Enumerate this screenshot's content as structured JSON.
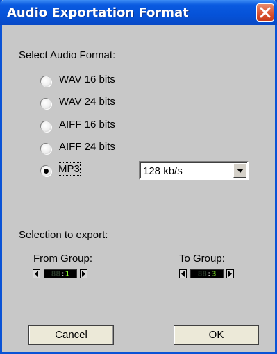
{
  "window": {
    "title": "Audio Exportation Format"
  },
  "format": {
    "label": "Select Audio Format:",
    "options": [
      {
        "label": "WAV 16 bits",
        "selected": false
      },
      {
        "label": "WAV 24 bits",
        "selected": false
      },
      {
        "label": "AIFF 16 bits",
        "selected": false
      },
      {
        "label": "AIFF 24 bits",
        "selected": false
      },
      {
        "label": "MP3",
        "selected": true
      }
    ],
    "bitrate": "128 kb/s"
  },
  "export": {
    "label": "Selection to export:",
    "from": {
      "label": "From Group:",
      "digits_dim": "88",
      "digit_lit": "1"
    },
    "to": {
      "label": "To Group:",
      "digits_dim": "88",
      "digit_lit": "3"
    }
  },
  "buttons": {
    "cancel": "Cancel",
    "ok": "OK"
  },
  "colors": {
    "titlebar": "#0552d8",
    "panel": "#c8c8c8",
    "lcd_lit": "#8dff2e"
  }
}
